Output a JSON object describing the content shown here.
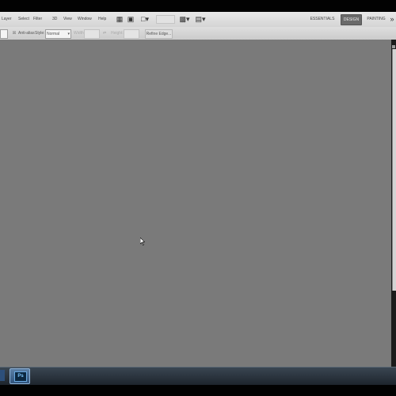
{
  "menubar": {
    "items": [
      "Layer",
      "Select",
      "Filter",
      "3D",
      "View",
      "Window",
      "Help"
    ],
    "workspaces": [
      "ESSENTIALS",
      "DESIGN",
      "PAINTING"
    ],
    "active_workspace": "DESIGN",
    "icons": [
      "bridge-icon",
      "minibridge-icon",
      "screen-mode-icon",
      "zoom-level-field",
      "arrange-documents-icon",
      "extras-icon"
    ]
  },
  "options_bar": {
    "size_value": "",
    "anti_alias_label": "Anti-alias",
    "style_label": "Style:",
    "style_value": "Normal",
    "width_label": "Width:",
    "height_label": "Height:",
    "refine_edge_label": "Refine Edge..."
  },
  "taskbar": {
    "app_label": "Ps",
    "app_name": "photoshop-taskbar-button"
  },
  "colors": {
    "canvas": "#7a7a7a",
    "menubar": "#dcdcdc",
    "taskbar": "#2a333c",
    "active_workspace": "#6a6a6a"
  }
}
